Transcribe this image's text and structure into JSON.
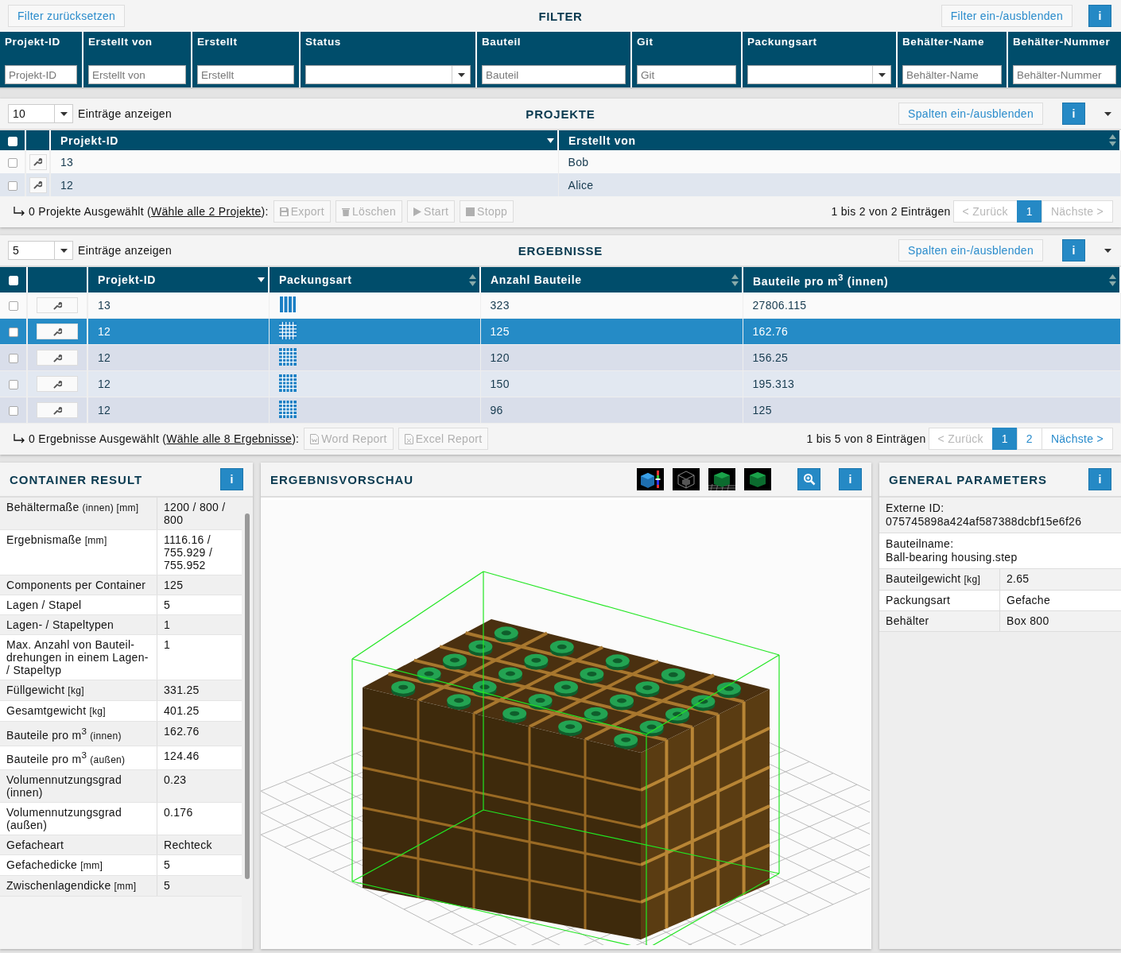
{
  "filter_bar": {
    "reset_button": "Filter zurücksetzen",
    "title": "FILTER",
    "toggle_button": "Filter ein-/ausblenden",
    "info_button": "i"
  },
  "filter_columns": [
    {
      "label": "Projekt-ID",
      "kind": "text",
      "placeholder": "Projekt-ID"
    },
    {
      "label": "Erstellt von",
      "kind": "text",
      "placeholder": "Erstellt von"
    },
    {
      "label": "Erstellt",
      "kind": "text",
      "placeholder": "Erstellt"
    },
    {
      "label": "Status",
      "kind": "select"
    },
    {
      "label": "Bauteil",
      "kind": "text",
      "placeholder": "Bauteil"
    },
    {
      "label": "Git",
      "kind": "text",
      "placeholder": "Git"
    },
    {
      "label": "Packungsart",
      "kind": "select"
    },
    {
      "label": "Behälter-Name",
      "kind": "text",
      "placeholder": "Behälter-Name"
    },
    {
      "label": "Behälter-Nummer",
      "kind": "text",
      "placeholder": "Behälter-Nummer"
    }
  ],
  "projects": {
    "page_size": "10",
    "page_size_label": "Einträge anzeigen",
    "title": "PROJEKTE",
    "columns_button": "Spalten ein-/ausblenden",
    "info_button": "i",
    "header_checked": false,
    "columns": [
      {
        "label": "Projekt-ID",
        "kind": "sorted_desc"
      },
      {
        "label": "Erstellt von",
        "kind": "sortable"
      }
    ],
    "rows": [
      {
        "checked": false,
        "cells": [
          "13",
          "Bob"
        ]
      },
      {
        "checked": false,
        "cells": [
          "12",
          "Alice"
        ]
      }
    ],
    "selection_before": "0 Projekte Ausgewählt (",
    "select_all_link": "Wähle alle 2 Projekte",
    "selection_after": "):",
    "actions": [
      {
        "label": "Export",
        "kind": "save",
        "disabled": true
      },
      {
        "label": "Löschen",
        "kind": "trash",
        "disabled": true
      },
      {
        "label": "Start",
        "kind": "play",
        "disabled": true
      },
      {
        "label": "Stopp",
        "kind": "stop",
        "disabled": true
      }
    ],
    "info": "1 bis 2 von 2 Einträgen",
    "prev": {
      "label": "< Zurück",
      "disabled": true
    },
    "pages": [
      {
        "label": "1",
        "selected": true
      }
    ],
    "next": {
      "label": "Nächste >",
      "disabled": true
    }
  },
  "results": {
    "page_size": "5",
    "page_size_label": "Einträge anzeigen",
    "title": "ERGEBNISSE",
    "columns_button": "Spalten ein-/ausblenden",
    "info_button": "i",
    "header_checked": false,
    "columns": [
      {
        "label": "Projekt-ID",
        "kind": "sorted_desc"
      },
      {
        "label": "Packungsart",
        "kind": "sortable"
      },
      {
        "label": "Anzahl Bauteile",
        "kind": "sortable"
      },
      {
        "label": "Bauteile pro m$^{3}$ (innen)",
        "kind": "sortable"
      }
    ],
    "rows": [
      {
        "checked": false,
        "selected": false,
        "project_id": "13",
        "kind": "stripes",
        "count": "323",
        "density": "27806.115"
      },
      {
        "checked": false,
        "selected": true,
        "project_id": "12",
        "kind": "grid",
        "count": "125",
        "density": "162.76"
      },
      {
        "checked": false,
        "selected": false,
        "project_id": "12",
        "kind": "grid",
        "count": "120",
        "density": "156.25"
      },
      {
        "checked": false,
        "selected": false,
        "project_id": "12",
        "kind": "grid",
        "count": "150",
        "density": "195.313"
      },
      {
        "checked": false,
        "selected": false,
        "project_id": "12",
        "kind": "grid",
        "count": "96",
        "density": "125"
      }
    ],
    "selection_before": "0 Ergebnisse Ausgewählt (",
    "select_all_link": "Wähle alle 8 Ergebnisse",
    "selection_after": "):",
    "actions": [
      {
        "label": "Word Report",
        "kind": "word",
        "disabled": true
      },
      {
        "label": "Excel Report",
        "kind": "excel",
        "disabled": true
      }
    ],
    "info": "1 bis 5 von 8 Einträgen",
    "prev": {
      "label": "< Zurück",
      "disabled": true
    },
    "pages": [
      {
        "label": "1",
        "selected": true
      },
      {
        "label": "2",
        "selected": false
      }
    ],
    "next": {
      "label": "Nächste >",
      "disabled": false
    }
  },
  "container_result": {
    "title": "CONTAINER RESULT",
    "info_button": "i",
    "rows": [
      {
        "label": "Behältermaße",
        "unit": "(innen) [mm]",
        "value": "1200 / 800 / 800"
      },
      {
        "label": "Ergebnismaße",
        "unit": "[mm]",
        "value": "1116.16 / 755.929 / 755.952"
      },
      {
        "label": "Components per Container",
        "value": "125"
      },
      {
        "label": "Lagen / Stapel",
        "value": "5"
      },
      {
        "label": "Lagen- / Stapeltypen",
        "value": "1"
      },
      {
        "label": "Max. Anzahl von Bauteil-drehungen in einem Lagen- / Stapeltyp",
        "value": "1"
      },
      {
        "label": "Füllgewicht",
        "unit": "[kg]",
        "value": "331.25"
      },
      {
        "label": "Gesamtgewicht",
        "unit": "[kg]",
        "value": "401.25"
      },
      {
        "label": "Bauteile pro m$^{3}$",
        "unit": "(innen)",
        "value": "162.76"
      },
      {
        "label": "Bauteile pro m$^{3}$",
        "unit": "(außen)",
        "value": "124.46"
      },
      {
        "label": "Volumennutzungsgrad (innen)",
        "value": "0.23"
      },
      {
        "label": "Volumennutzungsgrad (außen)",
        "value": "0.176"
      },
      {
        "label": "Gefacheart",
        "value": "Rechteck"
      },
      {
        "label": "Gefachedicke",
        "unit": "[mm]",
        "value": "5"
      },
      {
        "label": "Zwischenlagendicke",
        "unit": "[mm]",
        "value": "5"
      }
    ]
  },
  "preview": {
    "title": "ERGEBNISVORSCHAU",
    "info_button": "i"
  },
  "general_parameters": {
    "title": "GENERAL PARAMETERS",
    "info_button": "i",
    "rows": [
      {
        "kind": "stacked",
        "label": "Externe ID:",
        "value": "075745898a424af587388dcbf15e6f26"
      },
      {
        "kind": "stacked",
        "label": "Bauteilname:",
        "value": "Ball-bearing housing.step"
      },
      {
        "kind": "pair",
        "label": "Bauteilgewicht",
        "unit": "[kg]",
        "value": "2.65"
      },
      {
        "kind": "pair",
        "label": "Packungsart",
        "value": "Gefache"
      },
      {
        "kind": "pair",
        "label": "Behälter",
        "value": "Box 800"
      }
    ]
  }
}
